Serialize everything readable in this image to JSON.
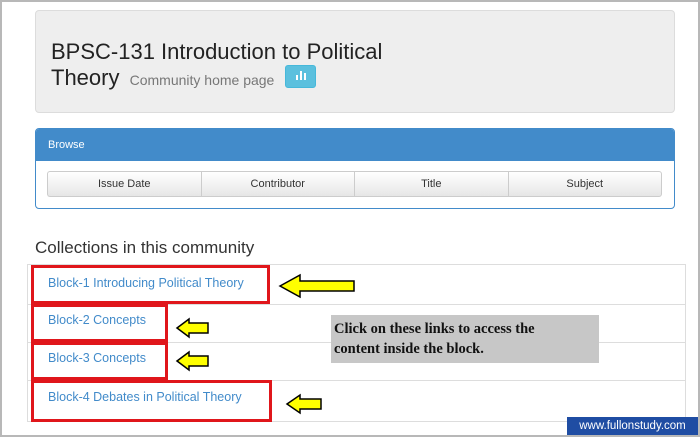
{
  "header": {
    "title_line1": "BPSC-131 Introduction to Political",
    "title_line2": "Theory",
    "subtitle": "Community home page",
    "stats_icon": "bar-chart-icon"
  },
  "browse": {
    "heading": "Browse",
    "buttons": [
      "Issue Date",
      "Contributor",
      "Title",
      "Subject"
    ]
  },
  "collections": {
    "title": "Collections in this community",
    "items": [
      "Block-1 Introducing Political Theory",
      "Block-2 Concepts",
      "Block-3 Concepts",
      "Block-4 Debates in Political Theory"
    ]
  },
  "annotation": {
    "callout_line1": "Click on these links to access the",
    "callout_line2": "content inside the block.",
    "highlight_color": "#e0161b",
    "arrow_color": "#ffff00"
  },
  "watermark": "www.fullonstudy.com",
  "colors": {
    "link": "#428bca",
    "panel": "#428bca",
    "stats_button": "#5bc0de"
  }
}
